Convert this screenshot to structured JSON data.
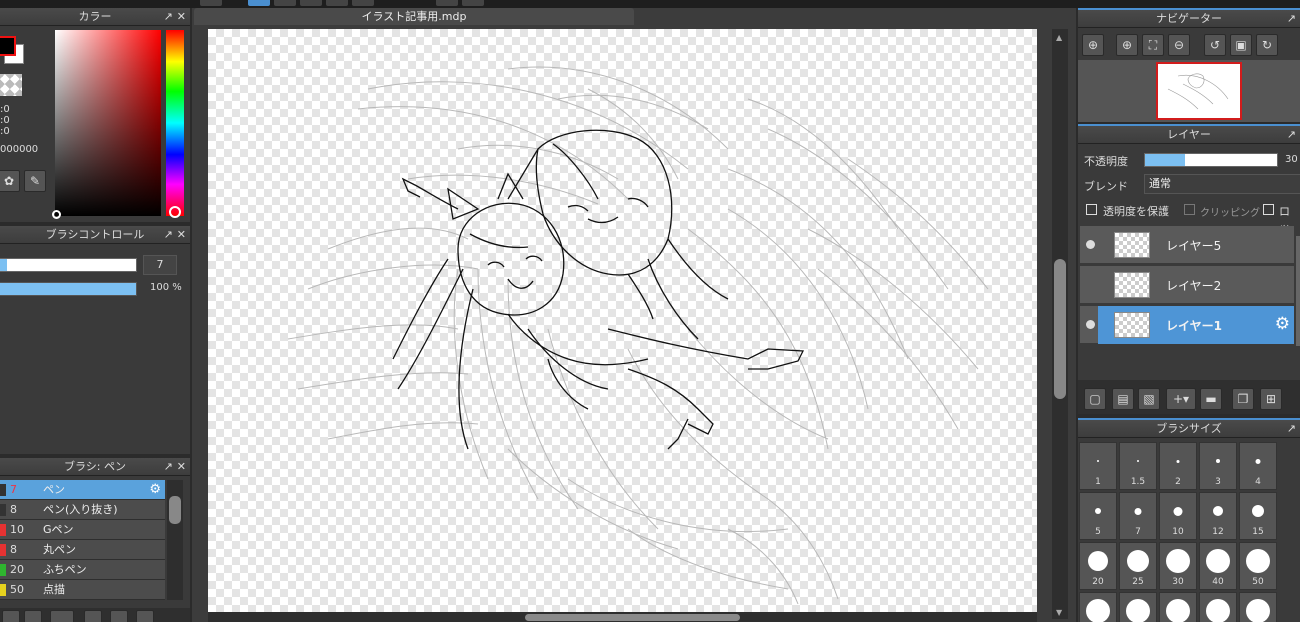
{
  "document": {
    "tab_title": "イラスト記事用.mdp"
  },
  "color_panel": {
    "title": "カラー",
    "float_icon": "↗",
    "close_icon": "✕",
    "r_value": ":0",
    "g_value": ":0",
    "b_value": ":0",
    "hex_value": "000000",
    "foreground_color": "#000000",
    "background_color": "#ffffff"
  },
  "brush_control": {
    "title": "ブラシコントロール",
    "size_value": "7",
    "opacity_value": "100 %",
    "size_level": 0.06,
    "opacity_level": 1.0
  },
  "brush_panel": {
    "title": "ブラシ: ペン",
    "items": [
      {
        "num": "7",
        "name": "ペン",
        "color": "#4a4a4a"
      },
      {
        "num": "8",
        "name": "ペン(入り抜き)",
        "color": "#4a4a4a"
      },
      {
        "num": "10",
        "name": "Gペン",
        "color": "#e63232"
      },
      {
        "num": "8",
        "name": "丸ペン",
        "color": "#e63232"
      },
      {
        "num": "20",
        "name": "ふちペン",
        "color": "#2fb52f"
      },
      {
        "num": "50",
        "name": "点描",
        "color": "#e6d21e"
      }
    ]
  },
  "navigator": {
    "title": "ナビゲーター",
    "buttons": [
      "zoom-fit-icon",
      "zoom-in-icon",
      "fit-screen-icon",
      "zoom-out-icon",
      "rotate-left-icon",
      "reset-view-icon",
      "rotate-right-icon"
    ]
  },
  "layers_panel": {
    "title": "レイヤー",
    "opacity_label": "不透明度",
    "opacity_value": "30",
    "opacity_level": 0.3,
    "blend_label": "ブレンド",
    "blend_value": "通常",
    "protect_alpha_label": "透明度を保護",
    "clipping_label": "クリッピング",
    "lock_label": "ロック",
    "layers": [
      {
        "name": "レイヤー5",
        "visible": true,
        "selected": false
      },
      {
        "name": "レイヤー2",
        "visible": false,
        "selected": false
      },
      {
        "name": "レイヤー1",
        "visible": true,
        "selected": true
      }
    ]
  },
  "brush_size_panel": {
    "title": "ブラシサイズ",
    "sizes": [
      "1",
      "1.5",
      "2",
      "3",
      "4",
      "5",
      "7",
      "10",
      "12",
      "15",
      "20",
      "25",
      "30",
      "40",
      "50",
      "",
      "",
      "",
      "",
      ""
    ]
  }
}
